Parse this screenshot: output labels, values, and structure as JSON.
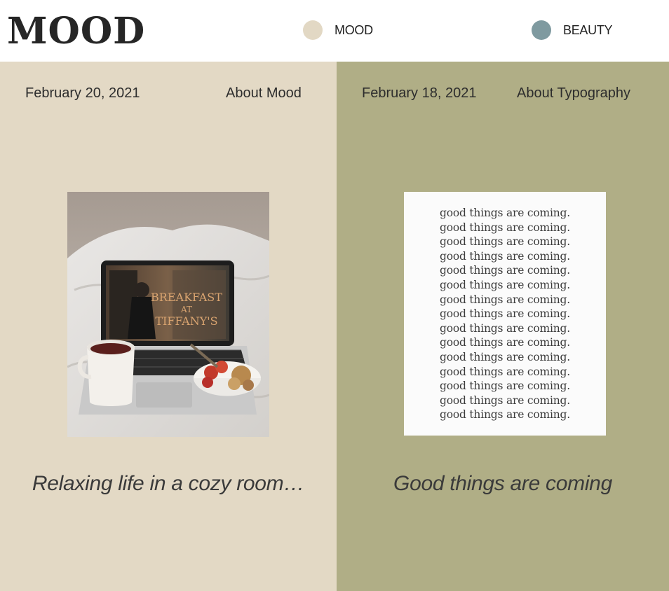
{
  "brand": {
    "title": "MOOD"
  },
  "nav": [
    {
      "label": "MOOD",
      "color": "#e2d8c4"
    },
    {
      "label": "BEAUTY",
      "color": "#7f9aa0"
    }
  ],
  "posts": [
    {
      "date": "February 20, 2021",
      "category": "About Mood",
      "caption": "Relaxing life in a cozy room…",
      "background": "#e3d9c5",
      "image": {
        "subject": "laptop on bed with tea and fruit bowl",
        "screen_text": [
          "BREAKFAST",
          "AT",
          "TIFFANY'S"
        ]
      }
    },
    {
      "date": "February 18, 2021",
      "category": "About Typography",
      "caption": "Good things are coming",
      "background": "#b0ae86",
      "image": {
        "subject": "typographic poster",
        "line_text": "good things are coming.",
        "line_count": 15
      }
    }
  ]
}
